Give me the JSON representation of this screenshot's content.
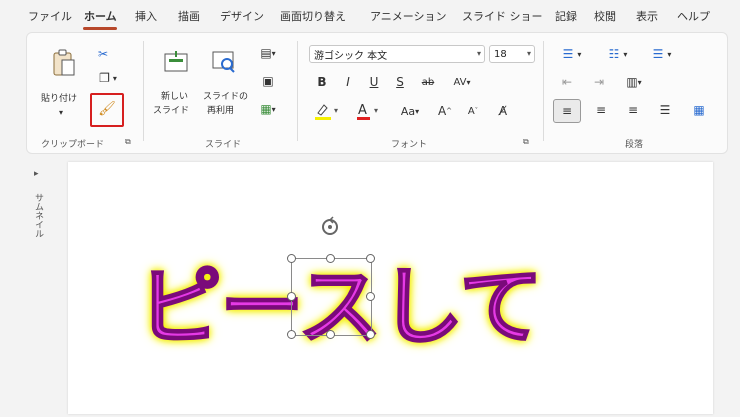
{
  "tabs": [
    "ファイル",
    "ホーム",
    "挿入",
    "描画",
    "デザイン",
    "画面切り替え",
    "アニメーション",
    "スライド ショー",
    "記録",
    "校閲",
    "表示",
    "ヘルプ"
  ],
  "clipboard": {
    "paste_label": "貼り付け",
    "group_label": "クリップボード"
  },
  "slides": {
    "new_slide_label1": "新しい",
    "new_slide_label2": "スライド",
    "reuse_label1": "スライドの",
    "reuse_label2": "再利用",
    "group_label": "スライド"
  },
  "font": {
    "family": "游ゴシック 本文",
    "size": "18",
    "group_label": "フォント"
  },
  "paragraph": {
    "group_label": "段落"
  },
  "side_panel": {
    "label": "サムネイル"
  },
  "slide": {
    "text": "ピースして"
  },
  "colors": {
    "highlight_box": "#d61f1f",
    "text_fill": "#e63ae6",
    "glow": "#f5f000",
    "font_color_bar": "#e02020",
    "highlight_bar": "#f5f000"
  }
}
